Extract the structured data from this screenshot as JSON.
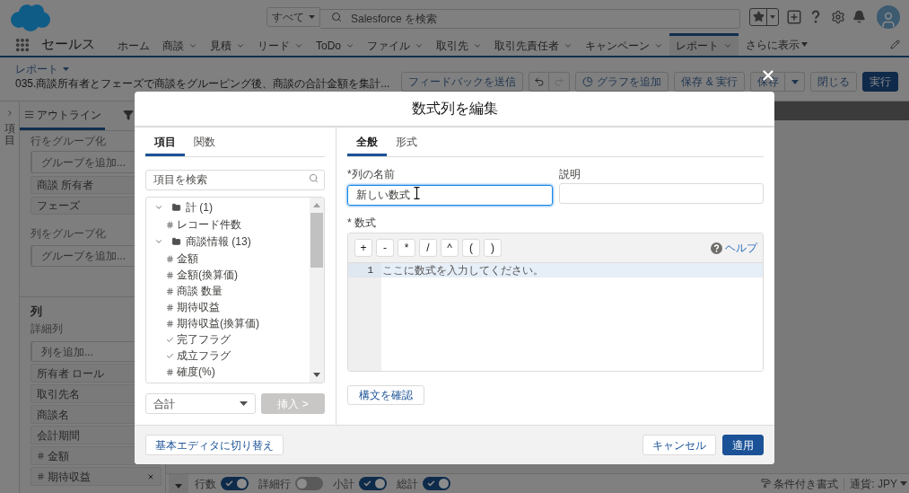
{
  "global_header": {
    "search_scope": "すべて",
    "search_placeholder": "Salesforce を検索"
  },
  "nav": {
    "app_name": "セールス",
    "tabs": [
      {
        "label": "ホーム",
        "has_menu": false,
        "selected": false
      },
      {
        "label": "商談",
        "has_menu": true,
        "selected": false
      },
      {
        "label": "見積",
        "has_menu": true,
        "selected": false
      },
      {
        "label": "リード",
        "has_menu": true,
        "selected": false
      },
      {
        "label": "ToDo",
        "has_menu": true,
        "selected": false
      },
      {
        "label": "ファイル",
        "has_menu": true,
        "selected": false
      },
      {
        "label": "取引先",
        "has_menu": true,
        "selected": false
      },
      {
        "label": "取引先責任者",
        "has_menu": true,
        "selected": false
      },
      {
        "label": "キャンペーン",
        "has_menu": true,
        "selected": false
      },
      {
        "label": "レポート",
        "has_menu": true,
        "selected": true
      }
    ],
    "more_label": "さらに表示"
  },
  "report_header": {
    "object_label": "レポート",
    "title": "035.商談所有者とフェーズで商談をグルーピング後、商談の合計金額を集計...",
    "buttons": [
      {
        "kind": "default",
        "label": "フィードバックを送信"
      },
      {
        "kind": "undo_redo",
        "undo_disabled": false,
        "redo_disabled": true
      },
      {
        "kind": "chart",
        "label": "グラフを追加"
      },
      {
        "kind": "default",
        "label": "保存 & 実行"
      },
      {
        "kind": "split",
        "label": "保存"
      },
      {
        "kind": "default",
        "label": "閉じる"
      },
      {
        "kind": "primary",
        "label": "実行"
      }
    ]
  },
  "side_rail": {
    "label": "項目"
  },
  "outline_panel": {
    "tabs": [
      {
        "kind": "outline",
        "label": "アウトライン",
        "selected": true
      },
      {
        "kind": "filters",
        "selected": false
      }
    ],
    "row_groups": {
      "label": "行をグループ化",
      "add_placeholder": "グループを追加...",
      "items": [
        "商談 所有者",
        "フェーズ"
      ]
    },
    "column_groups": {
      "label": "列をグループ化",
      "add_placeholder": "グループを追加..."
    },
    "columns": {
      "heading": "列",
      "detail_label": "詳細列",
      "add_placeholder": "列を追加...",
      "items": [
        {
          "label": "所有者 ロール",
          "kind": "text",
          "removable": false
        },
        {
          "label": "取引先名",
          "kind": "text",
          "removable": false
        },
        {
          "label": "商談名",
          "kind": "text",
          "removable": false
        },
        {
          "label": "会計期間",
          "kind": "text",
          "removable": false
        },
        {
          "label": "金額",
          "kind": "number",
          "removable": false
        },
        {
          "label": "期待収益",
          "kind": "number",
          "removable": true
        }
      ]
    }
  },
  "bottom_bar": {
    "toggles": [
      {
        "label": "行数",
        "on": true
      },
      {
        "label": "詳細行",
        "on": false
      },
      {
        "label": "小計",
        "on": true
      },
      {
        "label": "総計",
        "on": true
      }
    ],
    "conditional_formatting": "条件付き書式",
    "currency": "通貨: JPY"
  },
  "modal": {
    "title": "数式列を編集",
    "left_tabs": [
      {
        "label": "項目",
        "selected": true
      },
      {
        "label": "関数",
        "selected": false
      }
    ],
    "field_search": {
      "placeholder": "項目を検索"
    },
    "field_tree": [
      {
        "label": "計 (1)",
        "expanded": true,
        "children": [
          {
            "label": "レコード件数",
            "kind": "number"
          }
        ]
      },
      {
        "label": "商談情報 (13)",
        "expanded": true,
        "children": [
          {
            "label": "金額",
            "kind": "number"
          },
          {
            "label": "金額(換算価)",
            "kind": "number"
          },
          {
            "label": "商談 数量",
            "kind": "number"
          },
          {
            "label": "期待収益",
            "kind": "number"
          },
          {
            "label": "期待収益(換算価)",
            "kind": "number"
          },
          {
            "label": "完了フラグ",
            "kind": "checkbox"
          },
          {
            "label": "成立フラグ",
            "kind": "checkbox"
          },
          {
            "label": "確度(%)",
            "kind": "number"
          }
        ]
      }
    ],
    "summary_select": {
      "value": "合計"
    },
    "insert_button": {
      "label": "挿入 >",
      "disabled": true
    },
    "right_tabs": [
      {
        "label": "全般",
        "selected": true
      },
      {
        "label": "形式",
        "selected": false
      }
    ],
    "name_field": {
      "label": "*列の名前",
      "value": "新しい数式",
      "focused": true
    },
    "description_field": {
      "label": "説明"
    },
    "formula": {
      "label": "* 数式",
      "operators": [
        "+",
        "-",
        "*",
        "/",
        "^",
        "(",
        ")"
      ],
      "help_link": "ヘルプ",
      "lines": [
        {
          "number": "1",
          "placeholder": "ここに数式を入力してください。",
          "active": true
        }
      ]
    },
    "check_syntax_button": "構文を確認",
    "switch_editor_button": "基本エディタに切り替え",
    "cancel_button": "キャンセル",
    "apply_button": "適用"
  }
}
